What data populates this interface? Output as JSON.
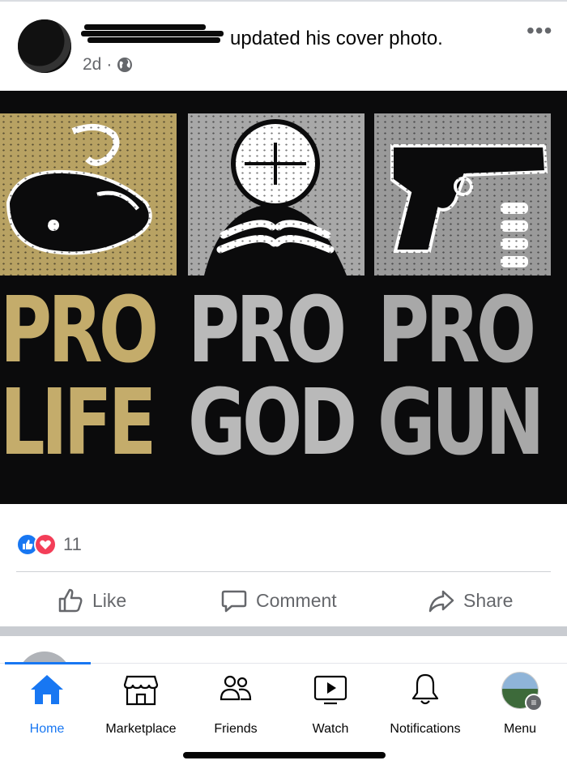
{
  "post": {
    "headline": "updated his cover photo.",
    "time": "2d",
    "dot": "·",
    "privacy_icon": "globe-icon",
    "more_icon": "more-icon",
    "image": {
      "row1": [
        "PRO",
        "PRO",
        "PRO"
      ],
      "row2": [
        "LIFE",
        "GOD",
        "GUN"
      ],
      "colors": {
        "gold": "#c4ac6b",
        "silver": "#b9b9b9",
        "background": "#0b0b0c"
      }
    },
    "reactions": {
      "count": "11",
      "types": [
        "like",
        "love"
      ]
    },
    "actions": {
      "like": "Like",
      "comment": "Comment",
      "share": "Share"
    }
  },
  "tabs": [
    {
      "label": "Home",
      "icon": "home-icon",
      "active": true
    },
    {
      "label": "Marketplace",
      "icon": "marketplace-icon"
    },
    {
      "label": "Friends",
      "icon": "friends-icon"
    },
    {
      "label": "Watch",
      "icon": "watch-icon"
    },
    {
      "label": "Notifications",
      "icon": "bell-icon"
    },
    {
      "label": "Menu",
      "icon": "avatar"
    }
  ],
  "colors": {
    "accent": "#1877f2",
    "secondary_text": "#65676b",
    "love": "#f33e58"
  }
}
